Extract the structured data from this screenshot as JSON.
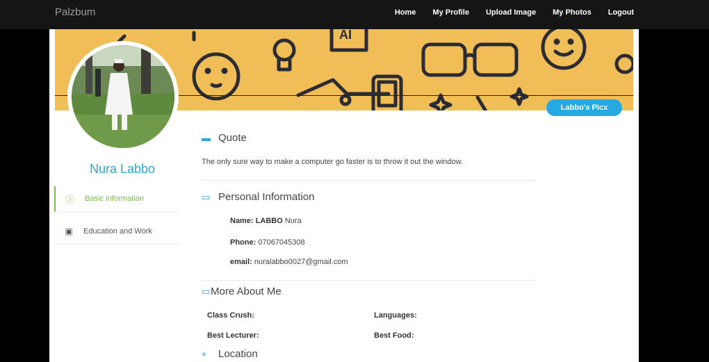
{
  "navbar": {
    "brand": "Palzbum",
    "links": [
      "Home",
      "My Profile",
      "Upload Image",
      "My Photos",
      "Logout"
    ]
  },
  "cover": {
    "button": "Labbo's Picx"
  },
  "profile": {
    "name": "Nura Labbo"
  },
  "sidebar": {
    "items": [
      {
        "label": "Basic Information",
        "icon": "info-icon"
      },
      {
        "label": "Education and Work",
        "icon": "briefcase-icon"
      }
    ]
  },
  "quote": {
    "title": "Quote",
    "text": "The only sure way to make a computer go faster is to throw it out the window."
  },
  "personal": {
    "title": "Personal Information",
    "name_label": "Name:",
    "name_bold": "LABBO",
    "name_rest": " Nura",
    "phone_label": "Phone:",
    "phone": " 07067045308",
    "email_label": "email:",
    "email": " nuralabbo0027@gmail.com"
  },
  "more": {
    "title": "More About Me",
    "class_crush": "Class Crush:",
    "languages": "Languages:",
    "best_lecturer": "Best Lecturer:",
    "best_food": "Best Food:"
  },
  "location": {
    "title": "Location"
  },
  "colors": {
    "accent": "#2aa4dc",
    "green": "#7abd44",
    "cover": "#f1bd56"
  }
}
